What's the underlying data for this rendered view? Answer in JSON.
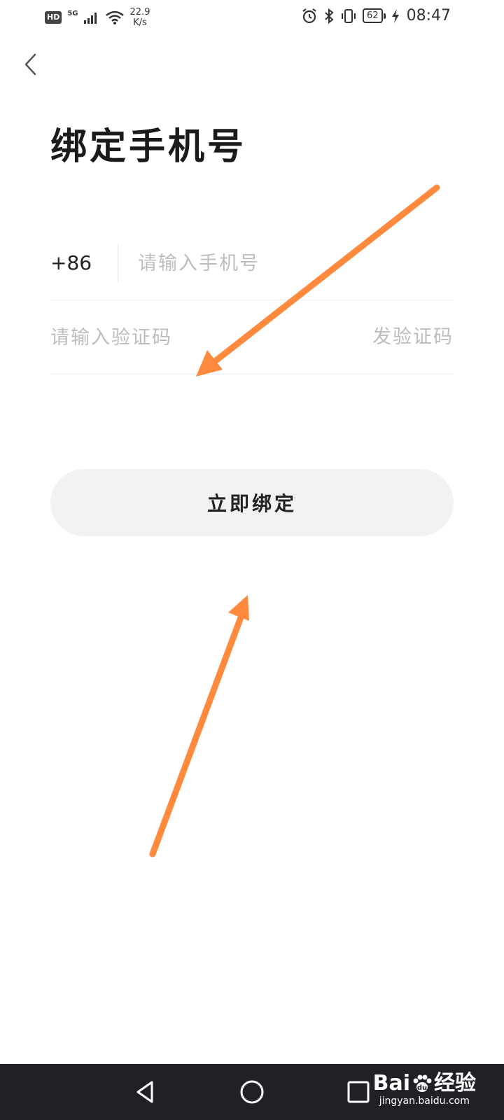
{
  "status_bar": {
    "hd_badge": "HD",
    "network": "5G",
    "speed_value": "22.9",
    "speed_unit": "K/s",
    "battery_level": "62",
    "time": "08:47",
    "icons": [
      "hd-icon",
      "cellular-signal-icon",
      "wifi-icon",
      "alarm-icon",
      "bluetooth-icon",
      "vibrate-icon",
      "battery-icon",
      "charging-icon"
    ]
  },
  "header": {
    "back_icon": "chevron-left-icon",
    "title": "绑定手机号"
  },
  "form": {
    "country_code": "+86",
    "phone_placeholder": "请输入手机号",
    "phone_value": "",
    "code_placeholder": "请输入验证码",
    "code_value": "",
    "send_code_label": "发验证码"
  },
  "actions": {
    "bind_label": "立即绑定"
  },
  "annotations": {
    "arrow_color": "#ff8a3d"
  },
  "nav_bar": {
    "icons": [
      "back-triangle-icon",
      "home-circle-icon",
      "recents-square-icon"
    ]
  },
  "watermark": {
    "logo_text_a": "Bai",
    "logo_text_b": "经验",
    "url": "jingyan.baidu.com"
  },
  "colors": {
    "background": "#ffffff",
    "button_bg": "#f2f2f2",
    "placeholder": "#bdbdbd",
    "nav_bar_bg": "#1f2127"
  }
}
